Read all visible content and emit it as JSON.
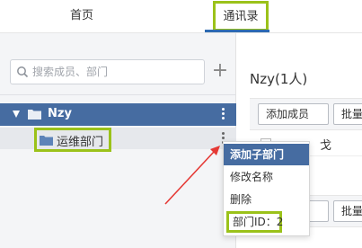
{
  "tabs": {
    "home": "首页",
    "contacts": "通讯录"
  },
  "search": {
    "placeholder": "搜索成员、部门",
    "icon": "search-icon"
  },
  "add_button": "+",
  "tree": {
    "root_label": "Nzy",
    "child_label": "运维部门"
  },
  "dept": {
    "title": "Nzy(1人)",
    "add_member": "添加成员",
    "batch": "批量"
  },
  "members": [
    {
      "name": "戈"
    }
  ],
  "context_menu": {
    "add_sub_dept": "添加子部门",
    "rename": "修改名称",
    "delete": "删除",
    "dept_id": "部门ID：2"
  },
  "colors": {
    "accent": "#466ca1",
    "highlight": "#9bc21a",
    "arrow": "#e53935"
  }
}
